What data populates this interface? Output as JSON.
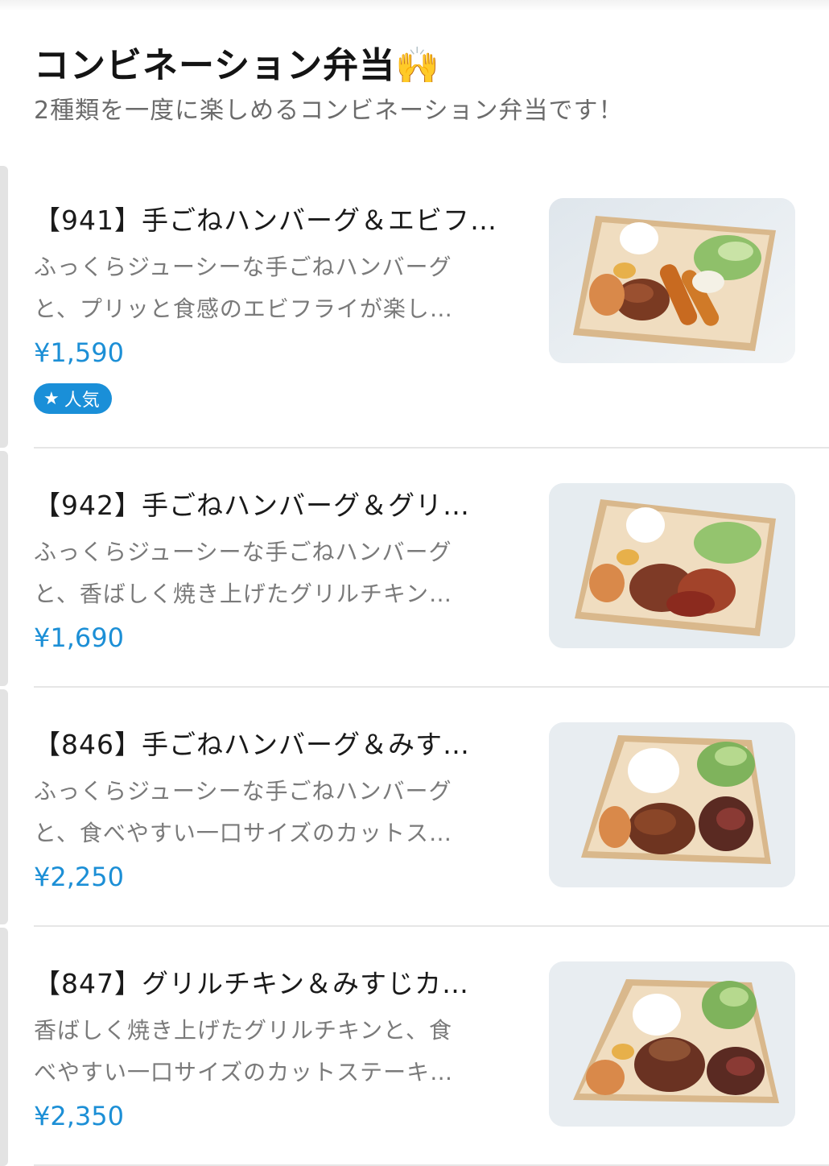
{
  "section": {
    "title": "コンビネーション弁当🙌",
    "subtitle": "2種類を一度に楽しめるコンビネーション弁当です！"
  },
  "items": [
    {
      "name": "【941】手ごねハンバーグ＆エビフ…",
      "desc_line1": "ふっくらジューシーな手ごねハンバーグ",
      "desc_line2": "と、プリッと食感のエビフライが楽し…",
      "price": "¥1,590",
      "badge": "人気",
      "badge_icon": "star-icon",
      "image": "bento-hamburg-ebifry"
    },
    {
      "name": "【942】手ごねハンバーグ＆グリ…",
      "desc_line1": "ふっくらジューシーな手ごねハンバーグ",
      "desc_line2": "と、香ばしく焼き上げたグリルチキン…",
      "price": "¥1,690",
      "image": "bento-hamburg-grillchicken"
    },
    {
      "name": "【846】手ごねハンバーグ＆みす…",
      "desc_line1": "ふっくらジューシーな手ごねハンバーグ",
      "desc_line2": "と、食べやすい一口サイズのカットス…",
      "price": "¥2,250",
      "image": "bento-hamburg-misuji"
    },
    {
      "name": "【847】グリルチキン＆みすじカ…",
      "desc_line1": "香ばしく焼き上げたグリルチキンと、食",
      "desc_line2": "べやすい一口サイズのカットステーキ…",
      "price": "¥2,350",
      "image": "bento-grillchicken-misuji"
    }
  ],
  "colors": {
    "price": "#1c8fd6",
    "badge_bg": "#1a8fd8",
    "title": "#141414",
    "description": "#7a7a7a",
    "divider": "#e6e6e6"
  }
}
